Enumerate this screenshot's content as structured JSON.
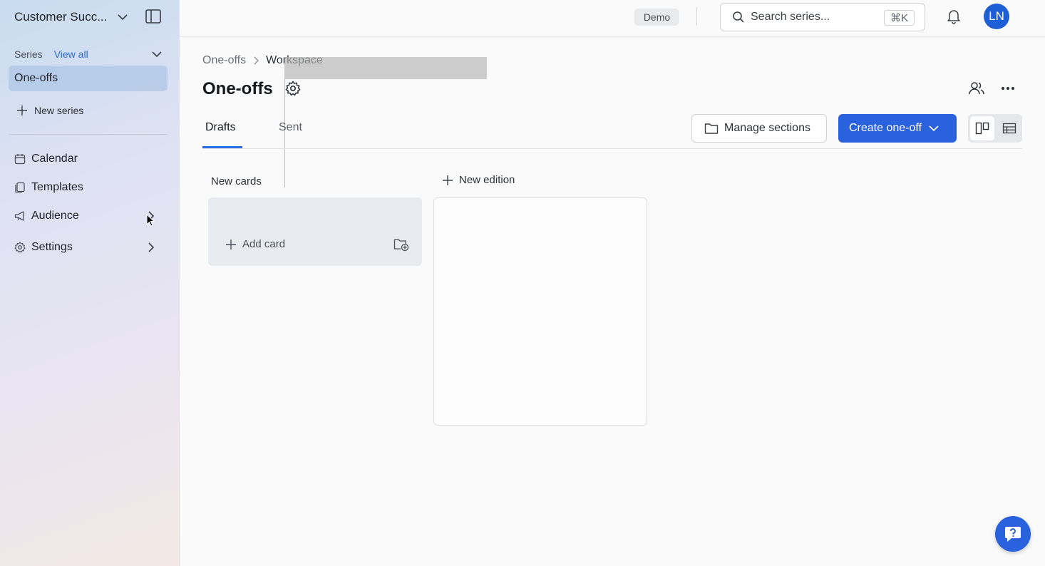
{
  "sidebar": {
    "workspace_name": "Customer Succ...",
    "series_label": "Series",
    "view_all": "View all",
    "active_item": "One-offs",
    "new_series": "New series",
    "nav": {
      "calendar": "Calendar",
      "templates": "Templates",
      "audience": "Audience",
      "settings": "Settings"
    }
  },
  "topbar": {
    "demo_badge": "Demo",
    "search_placeholder": "Search series...",
    "search_shortcut": "⌘K",
    "avatar_initials": "LN"
  },
  "main": {
    "breadcrumb": [
      "One-offs",
      "Workspace"
    ],
    "title": "One-offs",
    "tabs": [
      "Drafts",
      "Sent"
    ],
    "active_tab": "Drafts",
    "manage_sections": "Manage sections",
    "create_button": "Create one-off",
    "column_title": "New cards",
    "add_card": "Add card",
    "new_edition": "New edition"
  },
  "colors": {
    "accent": "#2a62dd",
    "avatar": "#1f5fd6"
  }
}
